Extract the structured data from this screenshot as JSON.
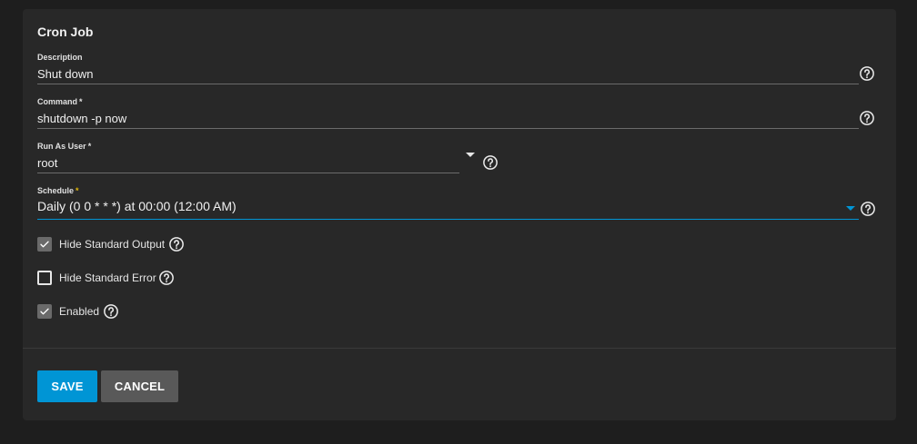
{
  "form": {
    "title": "Cron Job",
    "description": {
      "label": "Description",
      "value": "Shut down"
    },
    "command": {
      "label": "Command",
      "required_mark": "*",
      "value": "shutdown -p now"
    },
    "run_as_user": {
      "label": "Run As User",
      "required_mark": "*",
      "value": "root"
    },
    "schedule": {
      "label": "Schedule",
      "required_mark": "*",
      "value": "Daily (0 0 * * *) at 00:00 (12:00 AM)"
    },
    "checkboxes": [
      {
        "label": "Hide Standard Output",
        "checked": true
      },
      {
        "label": "Hide Standard Error",
        "checked": false
      },
      {
        "label": "Enabled",
        "checked": true
      }
    ],
    "buttons": {
      "save": "SAVE",
      "cancel": "CANCEL"
    }
  },
  "colors": {
    "background": "#1e1e1e",
    "card": "#282828",
    "accent": "#0095d5",
    "required": "#e2b70a",
    "secondary_button": "#595959"
  },
  "icons": {
    "help": "help-circle-icon",
    "dropdown": "caret-down-icon",
    "check": "check-icon"
  }
}
